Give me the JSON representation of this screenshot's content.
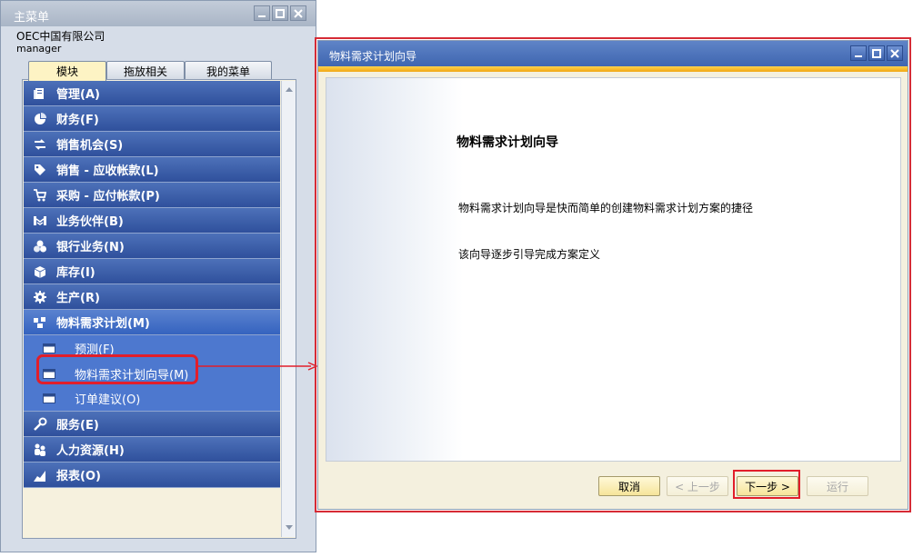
{
  "main_menu": {
    "title": "主菜单",
    "company": "OEC中国有限公司",
    "user": "manager",
    "tabs": [
      {
        "label": "模块",
        "active": true
      },
      {
        "label": "拖放相关",
        "active": false
      },
      {
        "label": "我的菜单",
        "active": false
      }
    ],
    "modules": [
      {
        "label": "管理(A)",
        "icon": "admin-icon"
      },
      {
        "label": "财务(F)",
        "icon": "finance-icon"
      },
      {
        "label": "销售机会(S)",
        "icon": "opportunity-icon"
      },
      {
        "label": "销售 - 应收帐款(L)",
        "icon": "tag-icon"
      },
      {
        "label": "采购 - 应付帐款(P)",
        "icon": "cart-icon"
      },
      {
        "label": "业务伙伴(B)",
        "icon": "partner-icon"
      },
      {
        "label": "银行业务(N)",
        "icon": "coins-icon"
      },
      {
        "label": "库存(I)",
        "icon": "box-icon"
      },
      {
        "label": "生产(R)",
        "icon": "gear-icon"
      },
      {
        "label": "物料需求计划(M)",
        "icon": "mrp-icon",
        "expanded": true,
        "children": [
          {
            "label": "预测(F)"
          },
          {
            "label": "物料需求计划向导(M)",
            "highlighted": true
          },
          {
            "label": "订单建议(O)"
          }
        ]
      },
      {
        "label": "服务(E)",
        "icon": "wrench-icon"
      },
      {
        "label": "人力资源(H)",
        "icon": "people-icon"
      },
      {
        "label": "报表(O)",
        "icon": "chart-icon"
      }
    ]
  },
  "wizard": {
    "title": "物料需求计划向导",
    "heading": "物料需求计划向导",
    "description1": "物料需求计划向导是快而简单的创建物料需求计划方案的捷径",
    "description2": "该向导逐步引导完成方案定义",
    "buttons": {
      "cancel": "取消",
      "back": "< 上一步",
      "next": "下一步 >",
      "run": "运行"
    }
  },
  "colors": {
    "annotation_red": "#e21e2a",
    "module_blue": "#2f509c",
    "wizard_gold": "#f1a614"
  }
}
